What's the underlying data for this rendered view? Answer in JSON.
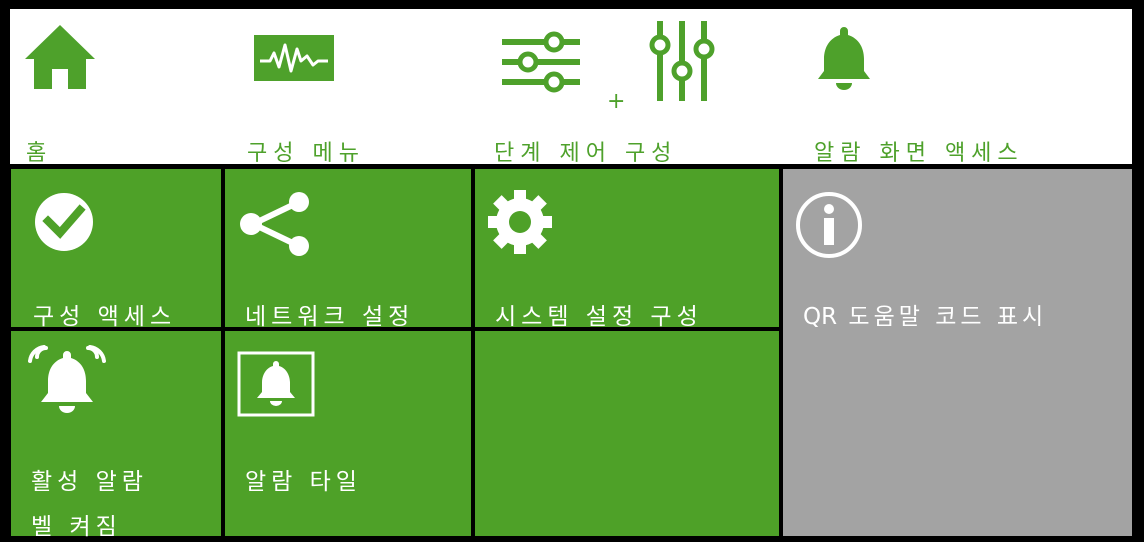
{
  "colors": {
    "accent": "#4ea12b",
    "tile_green": "#4ea128",
    "tile_gray": "#a3a3a3",
    "background": "#000000",
    "bar": "#ffffff"
  },
  "nav": {
    "home": {
      "label": "홈",
      "icon": "home-icon"
    },
    "config_menu": {
      "label": "구성 메뉴",
      "icon": "waveform-icon"
    },
    "step_control": {
      "label": "단계 제어 구성",
      "icon": "sliders-icon",
      "plus": "+"
    },
    "alarm_screen": {
      "label": "알람 화면 액세스",
      "icon": "bell-icon"
    }
  },
  "tiles": {
    "config_access": {
      "label": "구성 액세스",
      "icon": "clock-check-icon"
    },
    "network": {
      "label": "네트워크 설정",
      "icon": "share-icon"
    },
    "system": {
      "label": "시스템 설정 구성",
      "icon": "gear-icon"
    },
    "qr_help": {
      "label_prefix": "QR",
      "label": "도움말 코드 표시",
      "icon": "info-icon"
    },
    "active_alarm": {
      "line1": "활성 알람",
      "line2": "벨 켜짐",
      "icon": "ringing-bell-icon"
    },
    "alarm_tile": {
      "label": "알람 타일",
      "icon": "framed-bell-icon"
    }
  }
}
